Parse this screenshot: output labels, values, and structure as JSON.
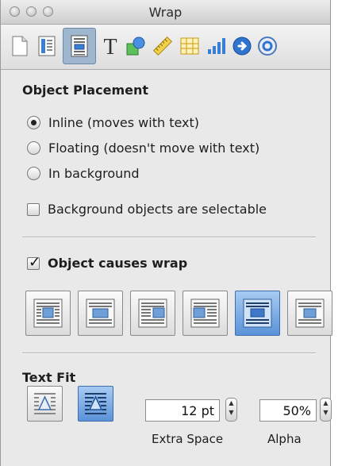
{
  "window": {
    "title": "Wrap"
  },
  "toolbar": {
    "buttons": [
      {
        "name": "document-inspector"
      },
      {
        "name": "layout-inspector"
      },
      {
        "name": "wrap-inspector",
        "active": true
      },
      {
        "name": "text-inspector"
      },
      {
        "name": "graphic-inspector"
      },
      {
        "name": "metrics-inspector"
      },
      {
        "name": "table-inspector"
      },
      {
        "name": "chart-inspector"
      },
      {
        "name": "hyperlink-inspector"
      },
      {
        "name": "quicktime-inspector"
      }
    ]
  },
  "placement": {
    "title": "Object Placement",
    "options": [
      {
        "label": "Inline (moves with text)",
        "selected": true
      },
      {
        "label": "Floating (doesn't move with text)",
        "selected": false
      },
      {
        "label": "In background",
        "selected": false
      }
    ],
    "selectable_label": "Background objects are selectable",
    "selectable_checked": false
  },
  "wrap": {
    "label": "Object causes wrap",
    "checked": true,
    "styles": [
      {
        "name": "wrap-both-sides",
        "selected": false
      },
      {
        "name": "wrap-around",
        "selected": false
      },
      {
        "name": "wrap-left",
        "selected": false
      },
      {
        "name": "wrap-right",
        "selected": false
      },
      {
        "name": "wrap-above-below",
        "selected": true
      },
      {
        "name": "wrap-none",
        "selected": false
      }
    ]
  },
  "textfit": {
    "title": "Text Fit",
    "modes": [
      {
        "name": "fit-rectangle",
        "selected": false
      },
      {
        "name": "fit-shape",
        "selected": true
      }
    ],
    "extra_space": {
      "value": "12 pt",
      "label": "Extra Space"
    },
    "alpha": {
      "value": "50%",
      "label": "Alpha"
    }
  },
  "colors": {
    "selected_blue": "#5b92d8",
    "panel_bg": "#e9e9e9"
  }
}
